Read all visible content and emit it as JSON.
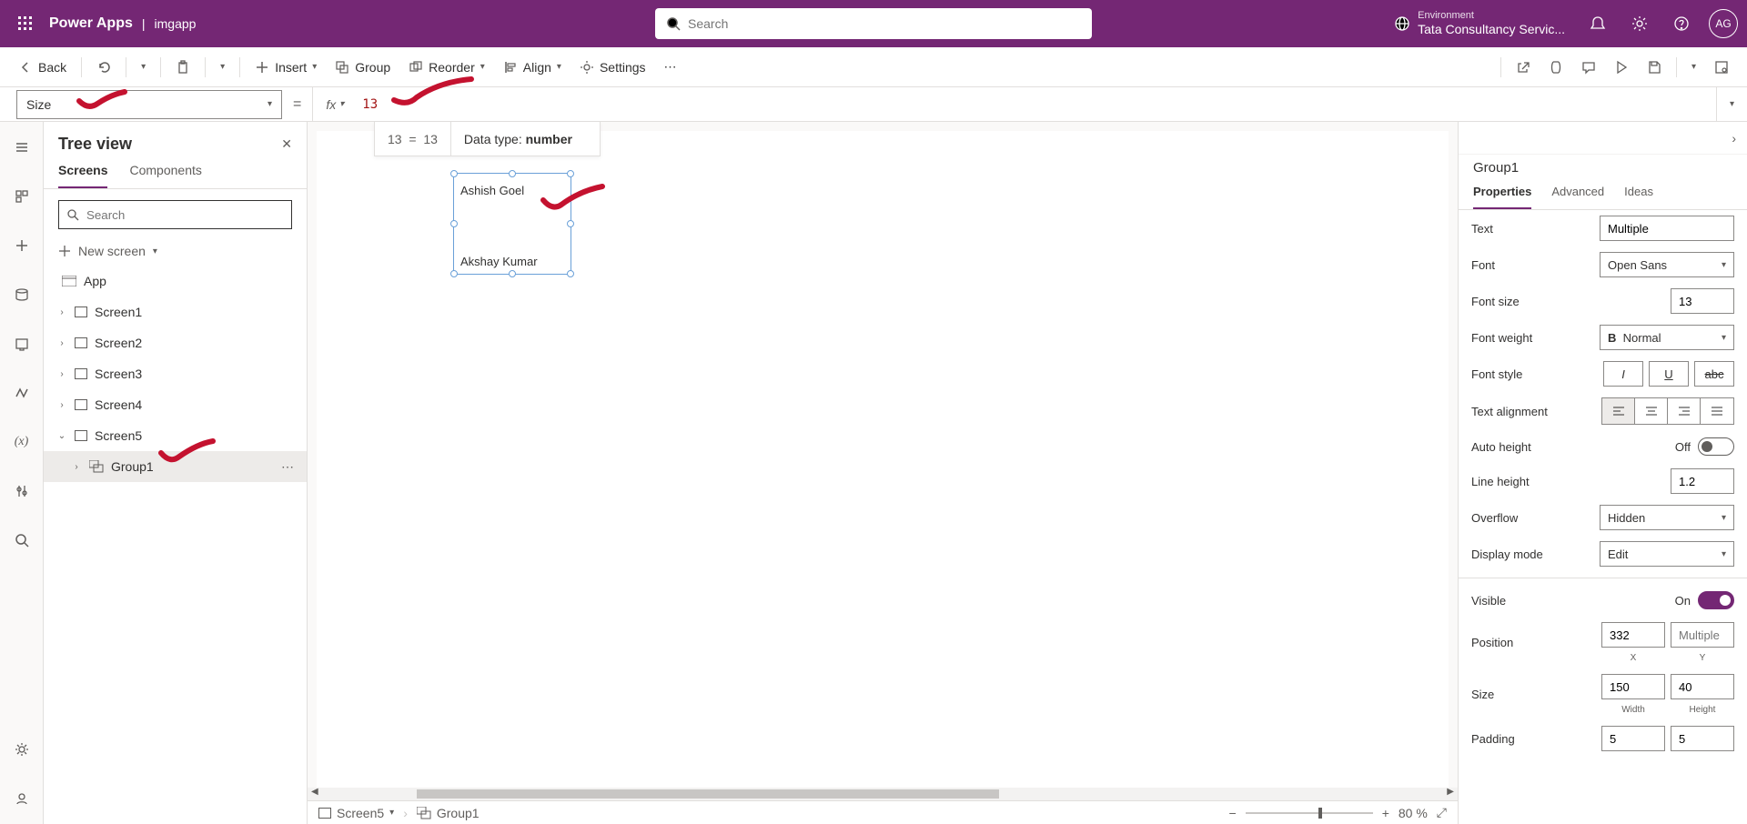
{
  "header": {
    "brand": "Power Apps",
    "app_name": "imgapp",
    "search_placeholder": "Search",
    "env_label": "Environment",
    "env_name": "Tata Consultancy Servic...",
    "avatar": "AG"
  },
  "cmd": {
    "back": "Back",
    "insert": "Insert",
    "group": "Group",
    "reorder": "Reorder",
    "align": "Align",
    "settings": "Settings"
  },
  "formula": {
    "property": "Size",
    "fx_label": "fx",
    "value": "13",
    "result_left": "13",
    "result_eq": "=",
    "result_right": "13",
    "dt_label": "Data type: ",
    "dt_value": "number"
  },
  "tree": {
    "title": "Tree view",
    "tab_screens": "Screens",
    "tab_components": "Components",
    "search_placeholder": "Search",
    "new_screen": "New screen",
    "app": "App",
    "screens": [
      "Screen1",
      "Screen2",
      "Screen3",
      "Screen4",
      "Screen5"
    ],
    "group": "Group1"
  },
  "canvas": {
    "label1": "Ashish Goel",
    "label2": "Akshay Kumar",
    "bc_screen": "Screen5",
    "bc_group": "Group1",
    "zoom_pct": "80 %"
  },
  "props": {
    "title": "Group1",
    "tab_props": "Properties",
    "tab_adv": "Advanced",
    "tab_ideas": "Ideas",
    "text_label": "Text",
    "text_val": "Multiple",
    "font_label": "Font",
    "font_val": "Open Sans",
    "fontsize_label": "Font size",
    "fontsize_val": "13",
    "fontweight_label": "Font weight",
    "fontweight_val": "Normal",
    "fontstyle_label": "Font style",
    "align_label": "Text alignment",
    "autoh_label": "Auto height",
    "autoh_val": "Off",
    "lineh_label": "Line height",
    "lineh_val": "1.2",
    "overflow_label": "Overflow",
    "overflow_val": "Hidden",
    "dispmode_label": "Display mode",
    "dispmode_val": "Edit",
    "visible_label": "Visible",
    "visible_val": "On",
    "pos_label": "Position",
    "pos_x": "332",
    "pos_y": "Multiple",
    "pos_xl": "X",
    "pos_yl": "Y",
    "size_label": "Size",
    "size_w": "150",
    "size_h": "40",
    "size_wl": "Width",
    "size_hl": "Height",
    "pad_label": "Padding",
    "pad_a": "5",
    "pad_b": "5"
  }
}
